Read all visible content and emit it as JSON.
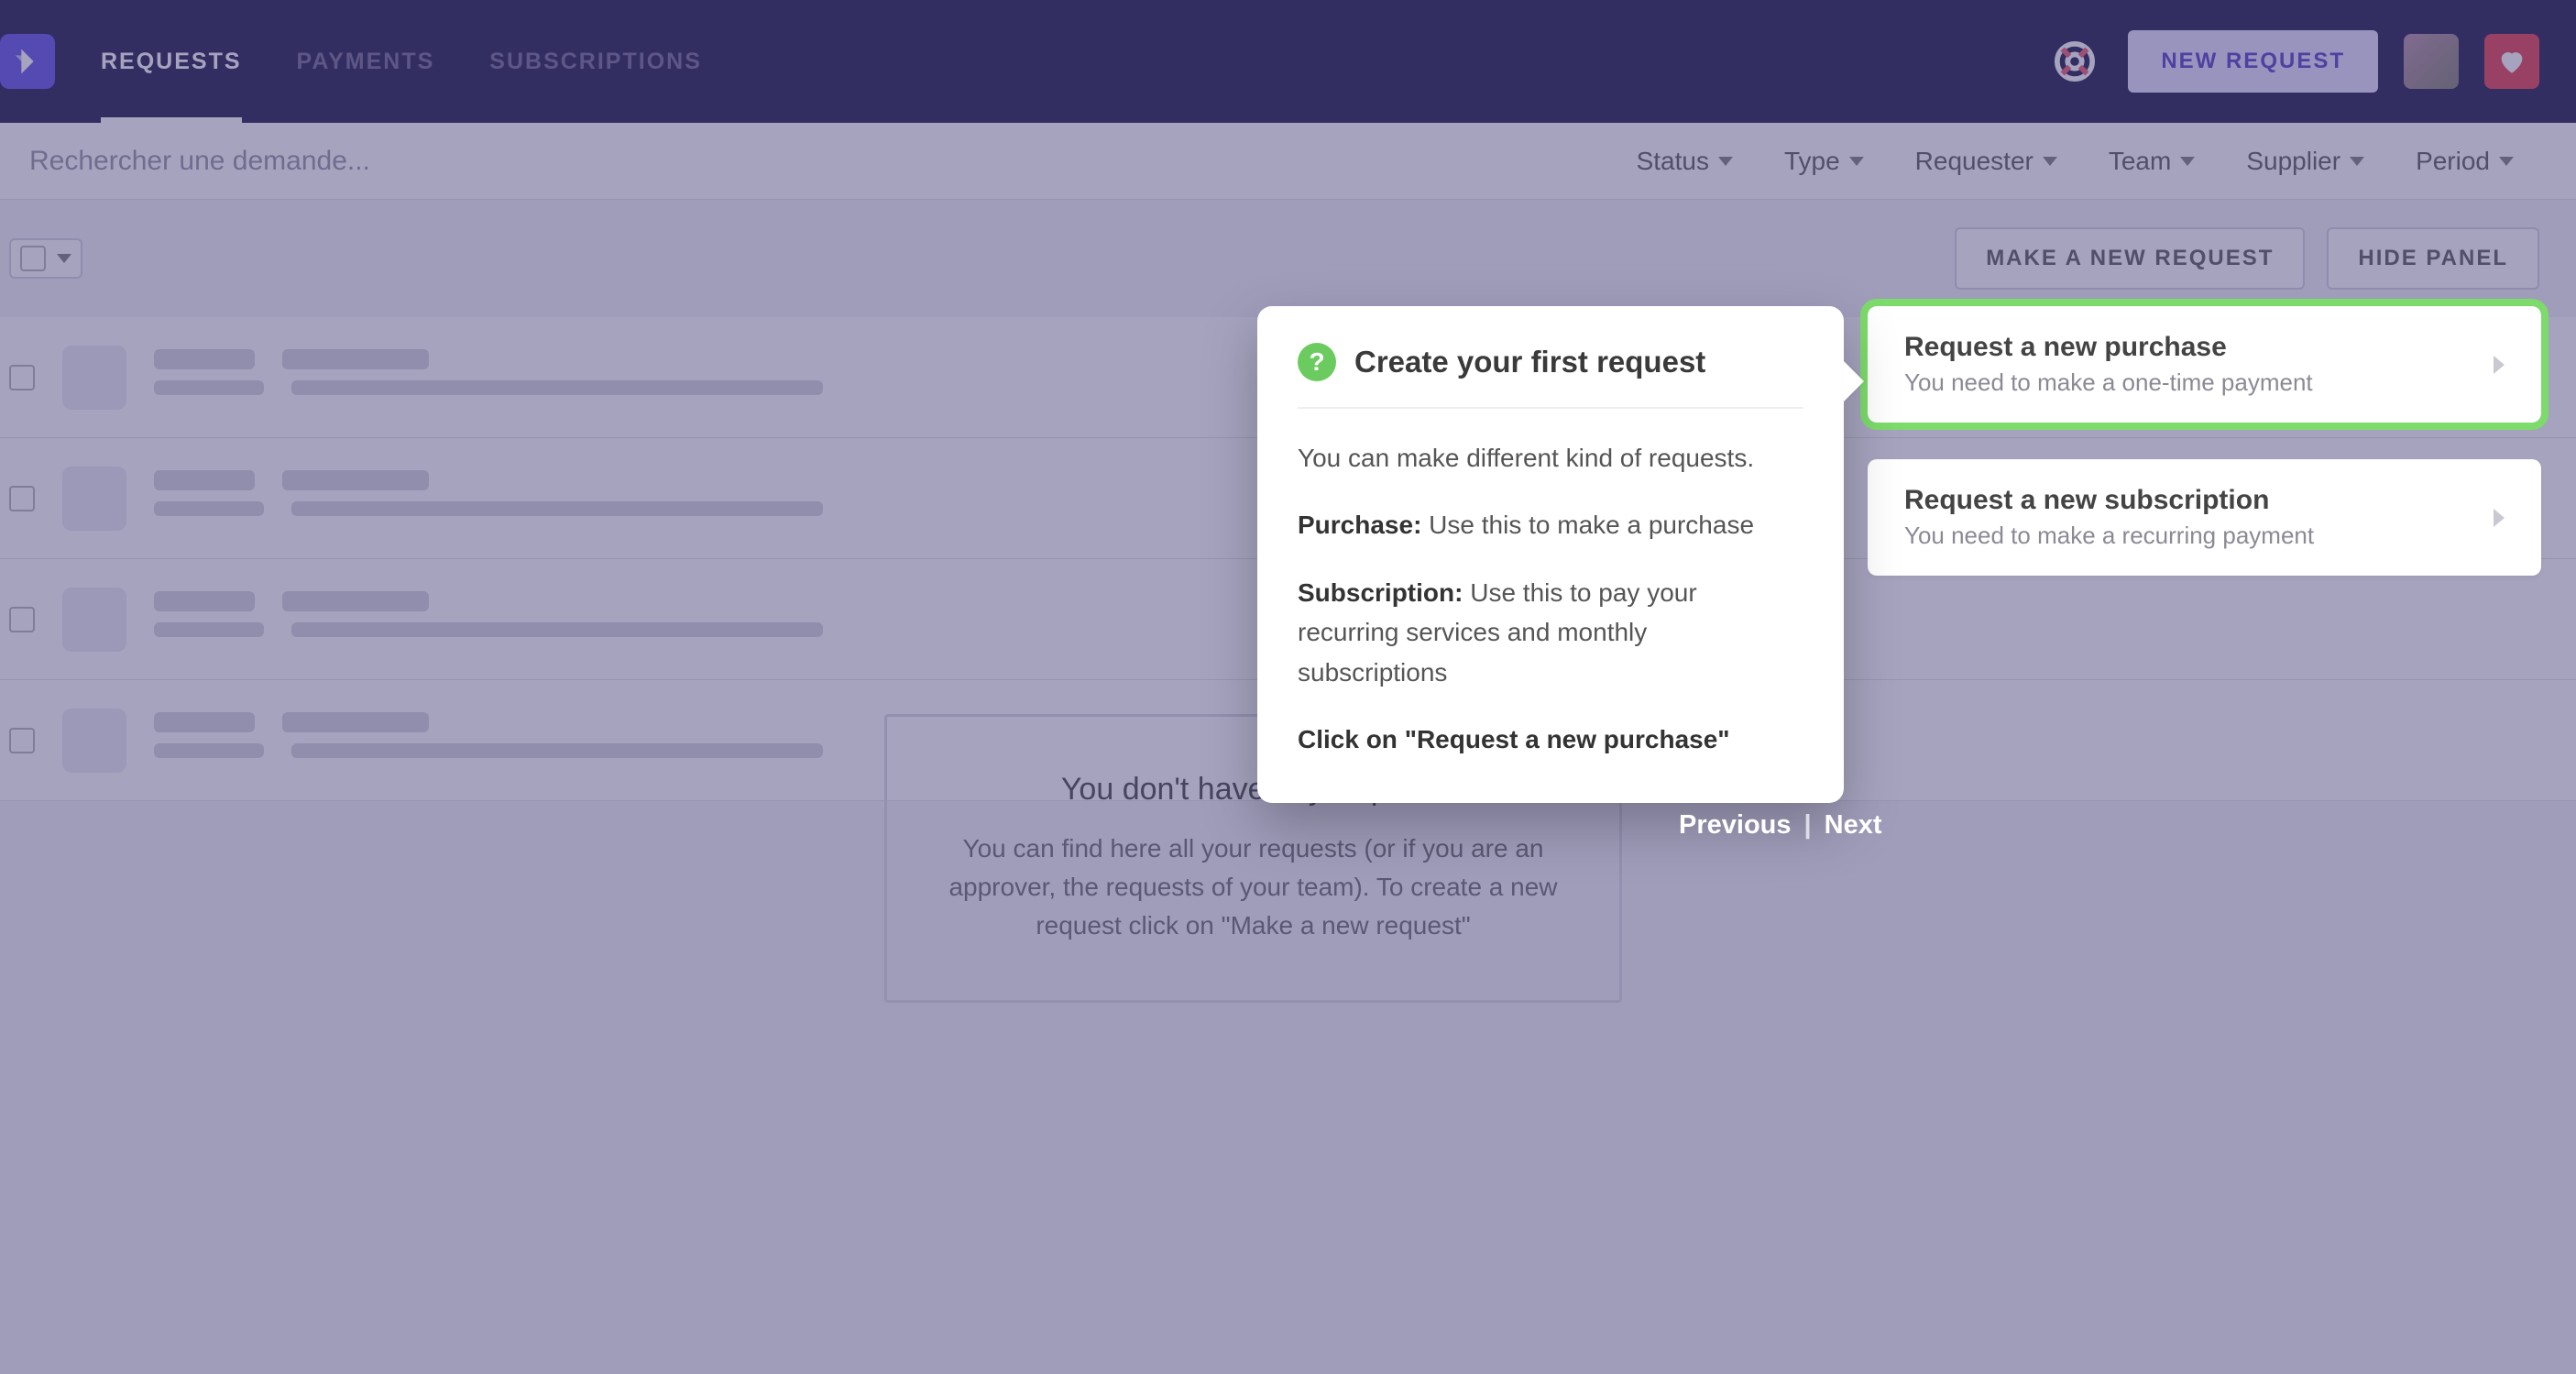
{
  "nav": {
    "requests": "REQUESTS",
    "payments": "PAYMENTS",
    "subscriptions": "SUBSCRIPTIONS",
    "new_request": "NEW REQUEST"
  },
  "filters": {
    "search_placeholder": "Rechercher une demande...",
    "status": "Status",
    "type": "Type",
    "requester": "Requester",
    "team": "Team",
    "supplier": "Supplier",
    "period": "Period"
  },
  "actions": {
    "make_new": "MAKE A NEW REQUEST",
    "hide_panel": "HIDE PANEL"
  },
  "empty": {
    "title": "You don't have any request.",
    "sub": "You can find here all your requests (or if you are an approver, the requests of your team). To create a new request click on \"Make a new request\""
  },
  "panel": {
    "purchase_title": "Request a new purchase",
    "purchase_sub": "You need to make a one-time payment",
    "subscription_title": "Request a new subscription",
    "subscription_sub": "You need to make a recurring payment"
  },
  "onboard": {
    "icon": "?",
    "title": "Create your first request",
    "p1": "You can make different kind of requests.",
    "purchase_label": "Purchase:",
    "purchase_text": " Use this to make a purchase",
    "subscription_label": "Subscription:",
    "subscription_text": " Use this to pay your recurring services and monthly subscriptions",
    "cta": "Click on \"Request a new purchase\"",
    "prev": "Previous",
    "next": "Next"
  }
}
